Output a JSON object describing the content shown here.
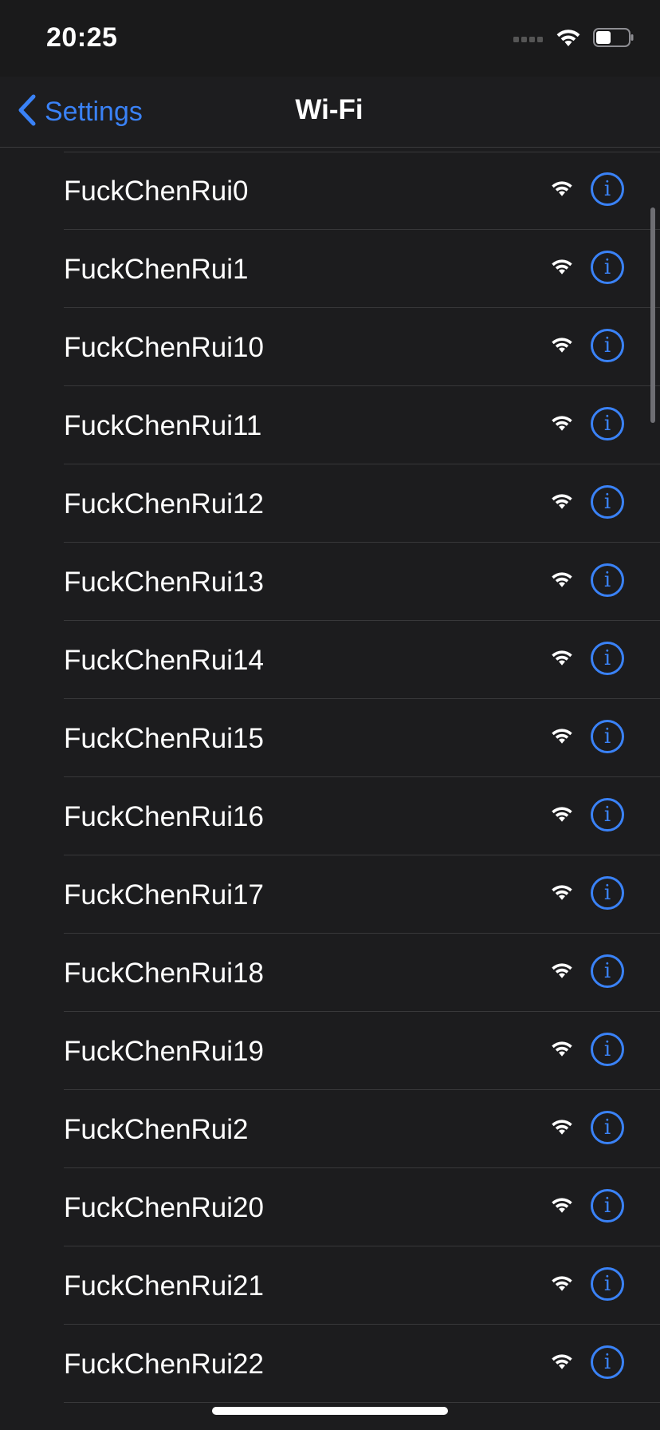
{
  "status_bar": {
    "time": "20:25",
    "icons": [
      "cellular-signal-icon",
      "wifi-icon",
      "battery-icon"
    ],
    "battery_level": 0.45
  },
  "nav": {
    "back_label": "Settings",
    "back_icon": "chevron-left-icon",
    "title": "Wi-Fi"
  },
  "networks": [
    {
      "name": "FuckChenRui0"
    },
    {
      "name": "FuckChenRui1"
    },
    {
      "name": "FuckChenRui10"
    },
    {
      "name": "FuckChenRui11"
    },
    {
      "name": "FuckChenRui12"
    },
    {
      "name": "FuckChenRui13"
    },
    {
      "name": "FuckChenRui14"
    },
    {
      "name": "FuckChenRui15"
    },
    {
      "name": "FuckChenRui16"
    },
    {
      "name": "FuckChenRui17"
    },
    {
      "name": "FuckChenRui18"
    },
    {
      "name": "FuckChenRui19"
    },
    {
      "name": "FuckChenRui2"
    },
    {
      "name": "FuckChenRui20"
    },
    {
      "name": "FuckChenRui21"
    },
    {
      "name": "FuckChenRui22"
    }
  ],
  "colors": {
    "accent": "#3a82f7",
    "background": "#1c1c1e",
    "separator": "#38383a"
  }
}
